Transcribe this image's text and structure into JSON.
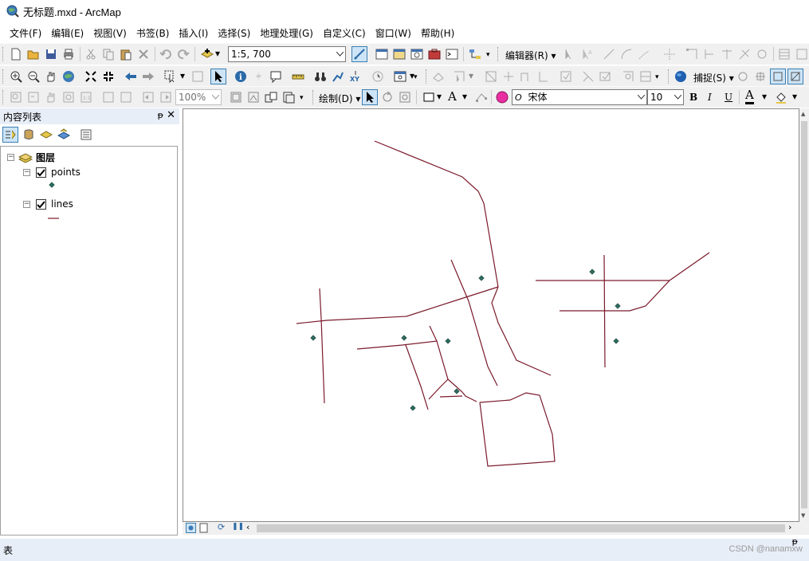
{
  "window": {
    "title": "无标题.mxd - ArcMap",
    "icon": "arcmap-globe-icon"
  },
  "menubar": {
    "items": [
      "文件(F)",
      "编辑(E)",
      "视图(V)",
      "书签(B)",
      "插入(I)",
      "选择(S)",
      "地理处理(G)",
      "自定义(C)",
      "窗口(W)",
      "帮助(H)"
    ]
  },
  "toolbar1": {
    "scale": "1:5, 700",
    "editor_label": "编辑器(R)"
  },
  "toolbar2": {
    "snapping_label": "捕捉(S)"
  },
  "toolbar3": {
    "zoom_percent": "100%",
    "draw_label": "绘制(D)",
    "font_name": "宋体",
    "font_size": "10",
    "bold": "B",
    "italic": "I",
    "underline": "U",
    "font_color_glyph": "A",
    "text_glyph": "A"
  },
  "toc": {
    "title": "内容列表",
    "root_label": "图层",
    "layers": [
      {
        "name": "points",
        "checked": true,
        "symbol": "diamond-point",
        "color": "#2e6b5e"
      },
      {
        "name": "lines",
        "checked": true,
        "symbol": "line",
        "color": "#7a1a2a"
      }
    ]
  },
  "map": {
    "line_color": "#7a1a2a",
    "point_color": "#2e6b5e",
    "point_outline": "#1f4a40"
  },
  "table_window": {
    "title": "表"
  },
  "watermark": "CSDN @nanamxw"
}
